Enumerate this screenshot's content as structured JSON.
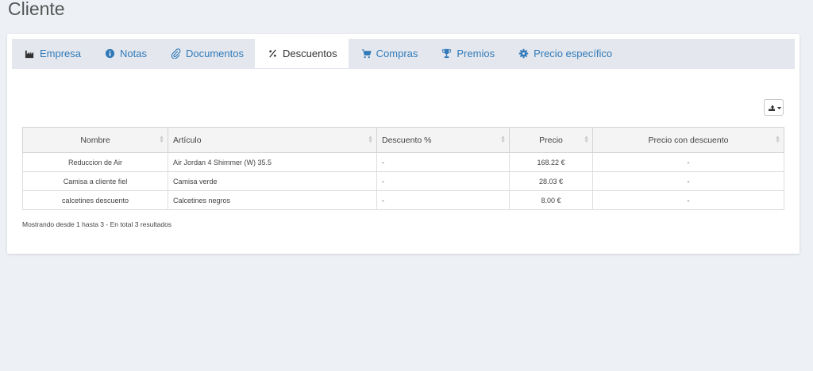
{
  "page": {
    "title": "Cliente"
  },
  "tabs": [
    {
      "label": "Empresa",
      "icon": "factory-icon",
      "active": false
    },
    {
      "label": "Notas",
      "icon": "info-circle-icon",
      "active": false
    },
    {
      "label": "Documentos",
      "icon": "paperclip-icon",
      "active": false
    },
    {
      "label": "Descuentos",
      "icon": "percent-icon",
      "active": true
    },
    {
      "label": "Compras",
      "icon": "shopping-cart-icon",
      "active": false
    },
    {
      "label": "Premios",
      "icon": "trophy-icon",
      "active": false
    },
    {
      "label": "Precio específico",
      "icon": "gear-icon",
      "active": false
    }
  ],
  "toolbar": {
    "export_icon": "export-icon"
  },
  "table": {
    "columns": [
      "Nombre",
      "Artículo",
      "Descuento %",
      "Precio",
      "Precio con descuento"
    ],
    "rows": [
      [
        "Reduccion de Air",
        "Air Jordan 4 Shimmer (W) 35.5",
        "-",
        "168.22 €",
        "-"
      ],
      [
        "Camisa a cliente fiel",
        "Camisa verde",
        "-",
        "28.03 €",
        "-"
      ],
      [
        "calcetines descuento",
        "Calcetines negros",
        "-",
        "8.00 €",
        "-"
      ]
    ]
  },
  "footer": {
    "summary": "Mostrando desde 1 hasta 3 - En total 3 resultados"
  },
  "colors": {
    "accent": "#3179b8",
    "background": "#edf0f5",
    "tab_bar": "#e4e8ee"
  }
}
